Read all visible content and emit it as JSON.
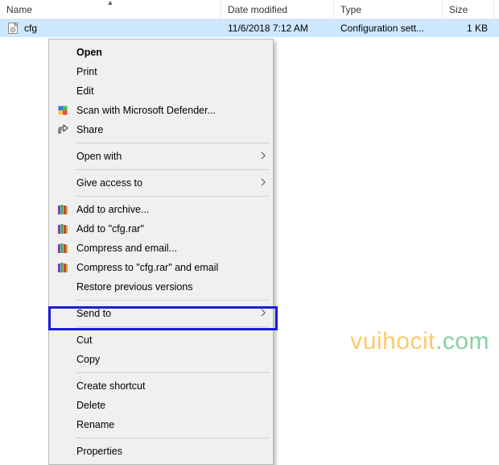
{
  "columns": {
    "name": "Name",
    "date": "Date modified",
    "type": "Type",
    "size": "Size"
  },
  "file": {
    "name": "cfg",
    "date": "11/6/2018 7:12 AM",
    "type": "Configuration sett...",
    "size": "1 KB"
  },
  "menu": {
    "open": "Open",
    "print": "Print",
    "edit": "Edit",
    "defender": "Scan with Microsoft Defender...",
    "share": "Share",
    "openwith": "Open with",
    "giveaccess": "Give access to",
    "addarchive": "Add to archive...",
    "addcfgrar": "Add to \"cfg.rar\"",
    "compressemail": "Compress and email...",
    "compresscfg": "Compress to \"cfg.rar\" and email",
    "restore": "Restore previous versions",
    "sendto": "Send to",
    "cut": "Cut",
    "copy": "Copy",
    "shortcut": "Create shortcut",
    "delete": "Delete",
    "rename": "Rename",
    "properties": "Properties"
  },
  "watermark": {
    "a": "vuihocit",
    "b": ".com"
  }
}
